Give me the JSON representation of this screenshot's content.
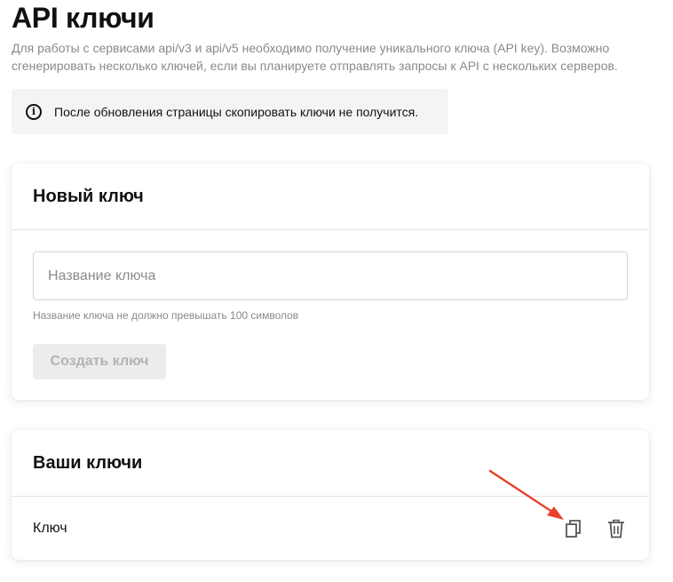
{
  "page": {
    "title": "API ключи",
    "description": "Для работы с сервисами api/v3 и api/v5 необходимо получение уникального ключа (API key). Возможно сгенерировать несколько ключей, если вы планируете отправлять запросы к API с нескольких серверов."
  },
  "notice": {
    "icon": "info-icon",
    "text": "После обновления страницы скопировать ключи не получится."
  },
  "new_key": {
    "title": "Новый ключ",
    "input_placeholder": "Название ключа",
    "input_value": "",
    "hint": "Название ключа не должно превышать 100 символов",
    "create_label": "Создать ключ"
  },
  "your_keys": {
    "title": "Ваши ключи",
    "rows": [
      {
        "label": "Ключ",
        "copy_icon": "copy-icon",
        "delete_icon": "trash-icon"
      }
    ]
  },
  "colors": {
    "annotation_arrow": "#e8412c",
    "muted_text": "#8a8a8a",
    "disabled_button_bg": "#ececec"
  }
}
